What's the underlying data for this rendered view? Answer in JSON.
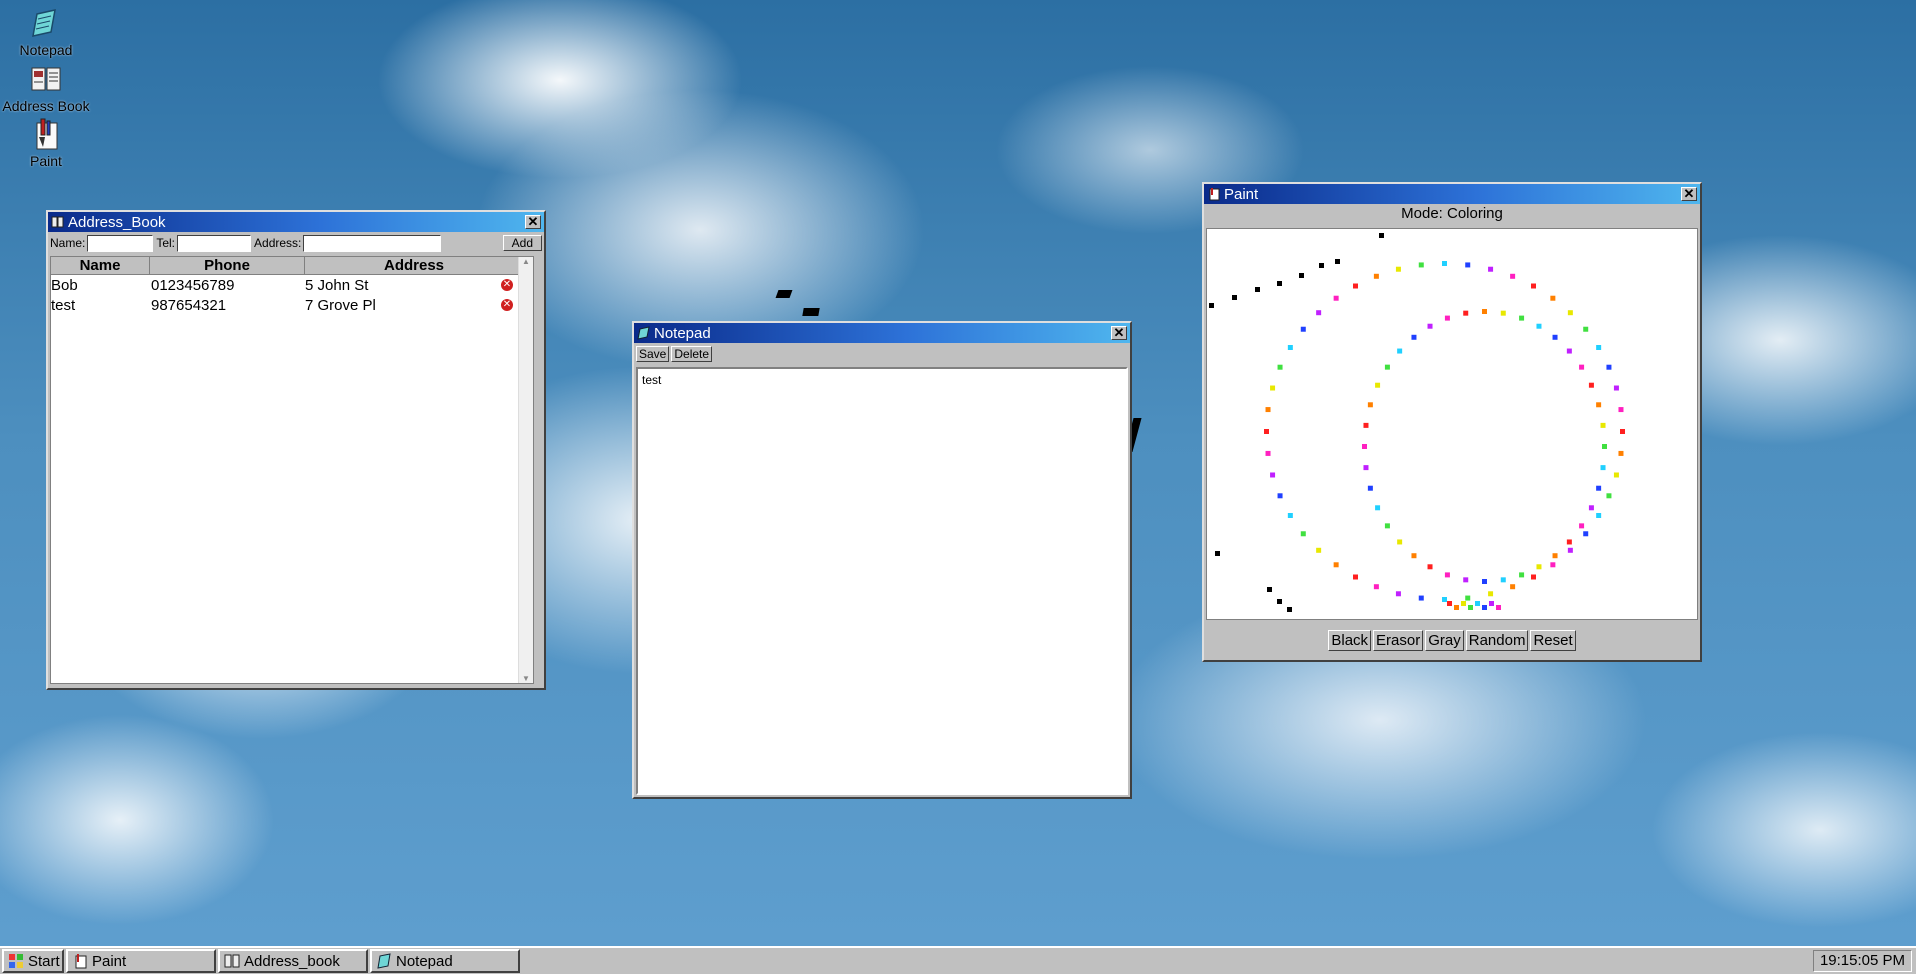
{
  "desktop": {
    "icons": [
      {
        "label": "Notepad"
      },
      {
        "label": "Address Book"
      },
      {
        "label": "Paint"
      }
    ]
  },
  "address_book": {
    "title": "Address_Book",
    "form": {
      "name_label": "Name:",
      "tel_label": "Tel:",
      "address_label": "Address:",
      "add_label": "Add",
      "name_value": "",
      "tel_value": "",
      "address_value": ""
    },
    "columns": [
      "Name",
      "Phone",
      "Address"
    ],
    "rows": [
      {
        "name": "Bob",
        "phone": "0123456789",
        "address": "5 John St"
      },
      {
        "name": "test",
        "phone": "987654321",
        "address": "7 Grove Pl"
      }
    ]
  },
  "notepad": {
    "title": "Notepad",
    "save_label": "Save",
    "delete_label": "Delete",
    "content": "test"
  },
  "paint": {
    "title": "Paint",
    "mode_text": "Mode: Coloring",
    "buttons": {
      "black": "Black",
      "erasor": "Erasor",
      "gray": "Gray",
      "random": "Random",
      "reset": "Reset"
    }
  },
  "taskbar": {
    "start_label": "Start",
    "tasks": [
      {
        "label": "Paint"
      },
      {
        "label": "Address_book"
      },
      {
        "label": "Notepad"
      }
    ],
    "clock": "19:15:05 PM"
  },
  "colors": {
    "title_start": "#0a2a8a",
    "title_end": "#4fb6ee",
    "face": "#c0c0c0"
  }
}
